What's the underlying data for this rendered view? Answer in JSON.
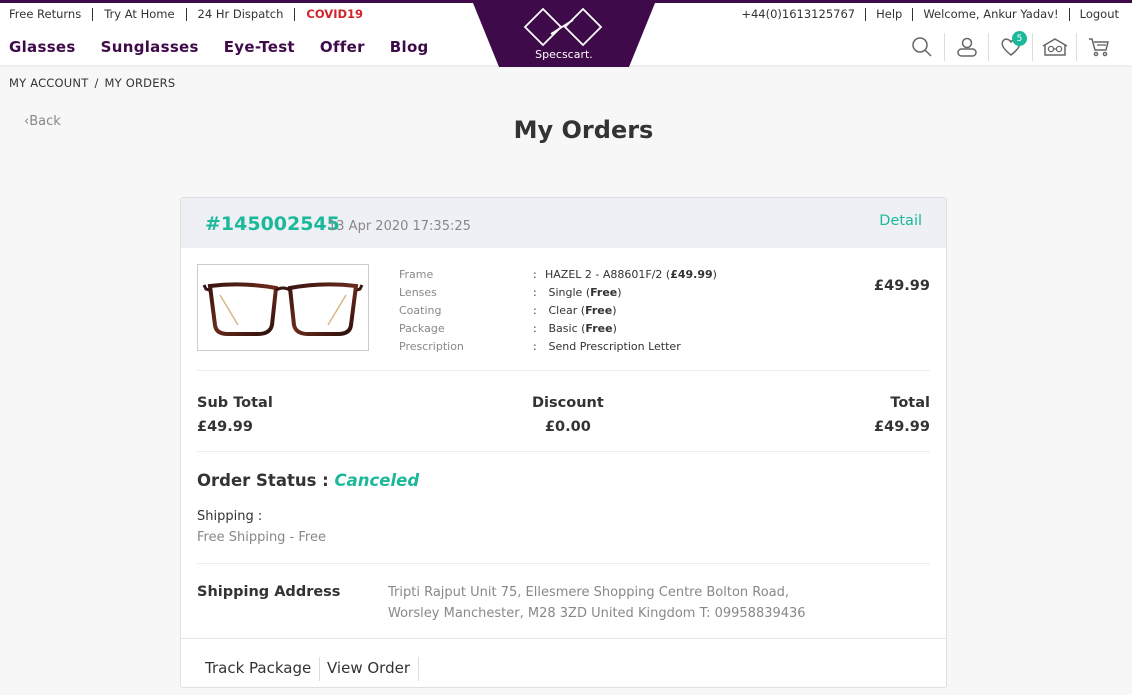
{
  "utility_left": [
    "Free Returns",
    "Try At Home",
    "24 Hr Dispatch",
    "COVID19"
  ],
  "utility_right": [
    "+44(0)1613125767",
    "Help",
    "Welcome, Ankur Yadav!",
    "Logout"
  ],
  "nav": [
    "Glasses",
    "Sunglasses",
    "Eye-Test",
    "Offer",
    "Blog"
  ],
  "brand": {
    "name": "Specscart.",
    "color": "#3f0a4a",
    "accent": "#1bb99a"
  },
  "header_icons": {
    "wishlist_count": "5"
  },
  "breadcrumb": [
    "MY ACCOUNT",
    "MY ORDERS"
  ],
  "back_label": "Back",
  "page_title": "My Orders",
  "order": {
    "id": "#145002545",
    "date": "13 Apr 2020 17:35:25",
    "detail_label": "Detail",
    "specs": [
      {
        "label": "Frame",
        "value": "HAZEL 2 - A88601F/2 (",
        "bold": "£49.99",
        "tail": ")"
      },
      {
        "label": "Lenses",
        "value": "Single (",
        "bold": "Free",
        "tail": ")"
      },
      {
        "label": "Coating",
        "value": "Clear (",
        "bold": "Free",
        "tail": ")"
      },
      {
        "label": "Package",
        "value": "Basic (",
        "bold": "Free",
        "tail": ")"
      },
      {
        "label": "Prescription",
        "value": "Send Prescription Letter",
        "bold": "",
        "tail": ""
      }
    ],
    "item_price": "£49.99",
    "subtotal_label": "Sub Total",
    "subtotal": "£49.99",
    "discount_label": "Discount",
    "discount": "£0.00",
    "total_label": "Total",
    "total": "£49.99",
    "status_label": "Order Status :",
    "status": "Canceled",
    "shipping_label": "Shipping :",
    "shipping_value": "Free Shipping - Free",
    "address_label": "Shipping Address",
    "address_line1": "Tripti Rajput Unit 75, Ellesmere Shopping Centre Bolton Road,",
    "address_line2": "Worsley Manchester, M28 3ZD United Kingdom T: 09958839436",
    "track_label": "Track Package",
    "view_label": "View Order"
  }
}
